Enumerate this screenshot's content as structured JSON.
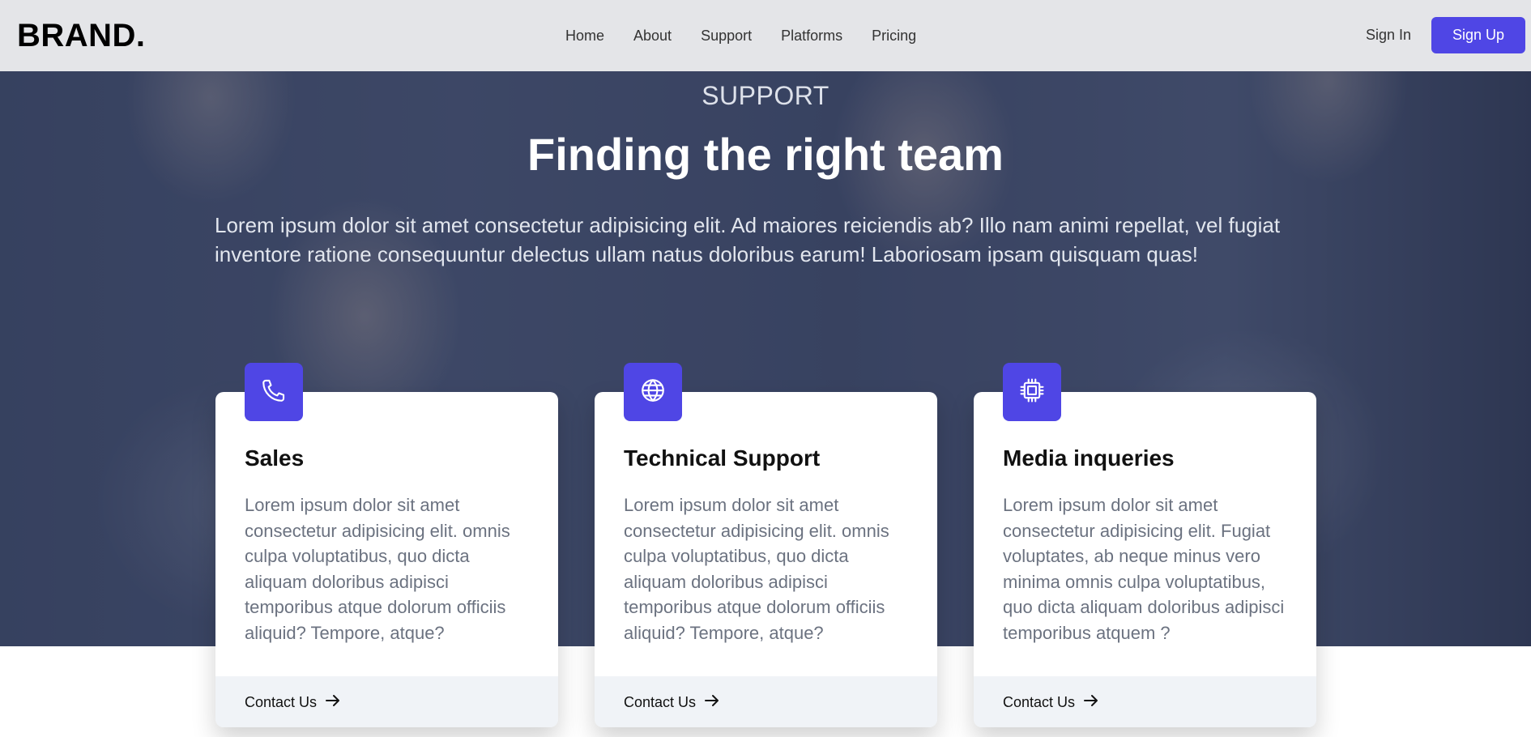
{
  "navbar": {
    "brand": "BRAND.",
    "links": [
      "Home",
      "About",
      "Support",
      "Platforms",
      "Pricing"
    ],
    "sign_in": "Sign In",
    "sign_up": "Sign Up"
  },
  "hero": {
    "eyebrow": "SUPPORT",
    "title": "Finding the right team",
    "lead": "Lorem ipsum dolor sit amet consectetur adipisicing elit. Ad maiores reiciendis ab? Illo nam animi repellat, vel fugiat inventore ratione consequuntur delectus ullam natus doloribus earum! Laboriosam ipsam quisquam quas!"
  },
  "cards": [
    {
      "icon": "phone-icon",
      "title": "Sales",
      "body": "Lorem ipsum dolor sit amet consectetur adipisicing elit. omnis culpa voluptatibus, quo dicta aliquam doloribus adipisci temporibus atque dolorum officiis aliquid? Tempore, atque?",
      "link": "Contact Us"
    },
    {
      "icon": "globe-icon",
      "title": "Technical Support",
      "body": "Lorem ipsum dolor sit amet consectetur adipisicing elit. omnis culpa voluptatibus, quo dicta aliquam doloribus adipisci temporibus atque dolorum officiis aliquid? Tempore, atque?",
      "link": "Contact Us"
    },
    {
      "icon": "chip-icon",
      "title": "Media inqueries",
      "body": "Lorem ipsum dolor sit amet consectetur adipisicing elit. Fugiat voluptates, ab neque minus vero minima omnis culpa voluptatibus, quo dicta aliquam doloribus adipisci temporibus atquem ?",
      "link": "Contact Us"
    }
  ],
  "colors": {
    "accent": "#4f46e5",
    "navbar_bg": "#e4e5e8",
    "card_footer_bg": "#f0f3f7"
  }
}
